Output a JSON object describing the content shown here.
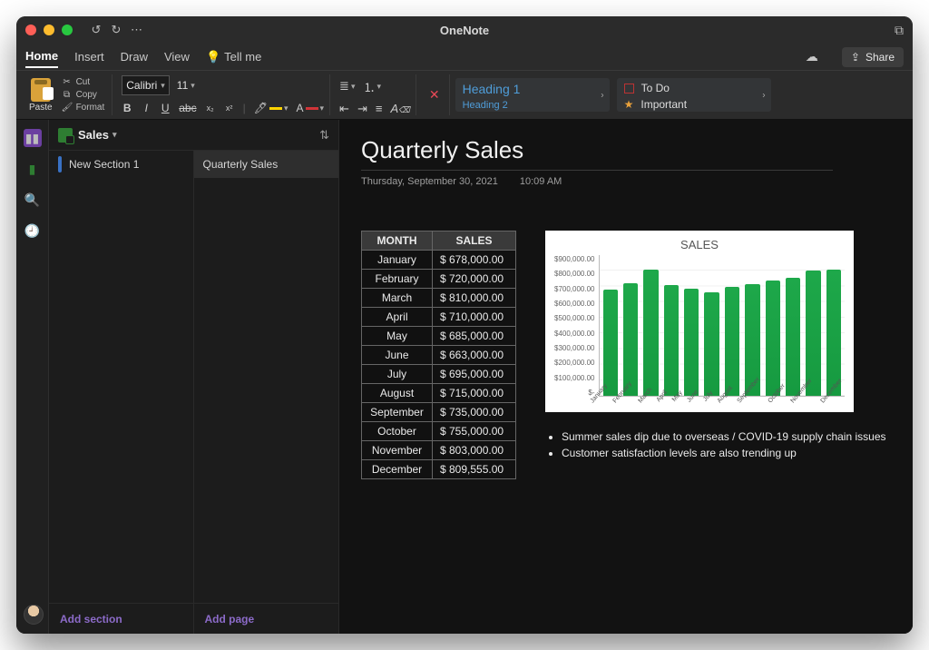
{
  "app": {
    "title": "OneNote"
  },
  "tabs": {
    "items": [
      "Home",
      "Insert",
      "Draw",
      "View"
    ],
    "active": "Home",
    "tellme": "Tell me",
    "share": "Share"
  },
  "ribbon": {
    "paste": "Paste",
    "cut": "Cut",
    "copy": "Copy",
    "format": "Format",
    "font_name": "Calibri",
    "font_size": "11",
    "styles": {
      "h1": "Heading 1",
      "h2": "Heading 2"
    },
    "tags": {
      "todo": "To Do",
      "important": "Important"
    }
  },
  "notebook": {
    "name": "Sales",
    "sections": [
      {
        "label": "New Section 1"
      }
    ],
    "pages": [
      {
        "label": "Quarterly Sales",
        "selected": true
      }
    ],
    "add_section": "Add section",
    "add_page": "Add page"
  },
  "page": {
    "title": "Quarterly Sales",
    "date": "Thursday, September 30, 2021",
    "time": "10:09 AM",
    "table_headers": {
      "month": "MONTH",
      "sales": "SALES"
    },
    "table_rows": [
      {
        "month": "January",
        "sales": "$ 678,000.00"
      },
      {
        "month": "February",
        "sales": "$ 720,000.00"
      },
      {
        "month": "March",
        "sales": "$ 810,000.00"
      },
      {
        "month": "April",
        "sales": "$ 710,000.00"
      },
      {
        "month": "May",
        "sales": "$ 685,000.00"
      },
      {
        "month": "June",
        "sales": "$ 663,000.00"
      },
      {
        "month": "July",
        "sales": "$ 695,000.00"
      },
      {
        "month": "August",
        "sales": "$ 715,000.00"
      },
      {
        "month": "September",
        "sales": "$ 735,000.00"
      },
      {
        "month": "October",
        "sales": "$ 755,000.00"
      },
      {
        "month": "November",
        "sales": "$ 803,000.00"
      },
      {
        "month": "December",
        "sales": "$ 809,555.00"
      }
    ],
    "bullets": [
      "Summer sales dip due to overseas / COVID-19 supply chain issues",
      "Customer satisfaction levels are also trending up"
    ]
  },
  "chart_data": {
    "type": "bar",
    "title": "SALES",
    "xlabel": "",
    "ylabel": "",
    "categories": [
      "January",
      "February",
      "March",
      "April",
      "May",
      "June",
      "July",
      "August",
      "September",
      "October",
      "November",
      "December"
    ],
    "values": [
      678000,
      720000,
      810000,
      710000,
      685000,
      663000,
      695000,
      715000,
      735000,
      755000,
      803000,
      809555
    ],
    "ylim": [
      0,
      900000
    ],
    "y_ticks": [
      "$900,000.00",
      "$800,000.00",
      "$700,000.00",
      "$600,000.00",
      "$500,000.00",
      "$400,000.00",
      "$300,000.00",
      "$200,000.00",
      "$100,000.00",
      "$-"
    ]
  }
}
